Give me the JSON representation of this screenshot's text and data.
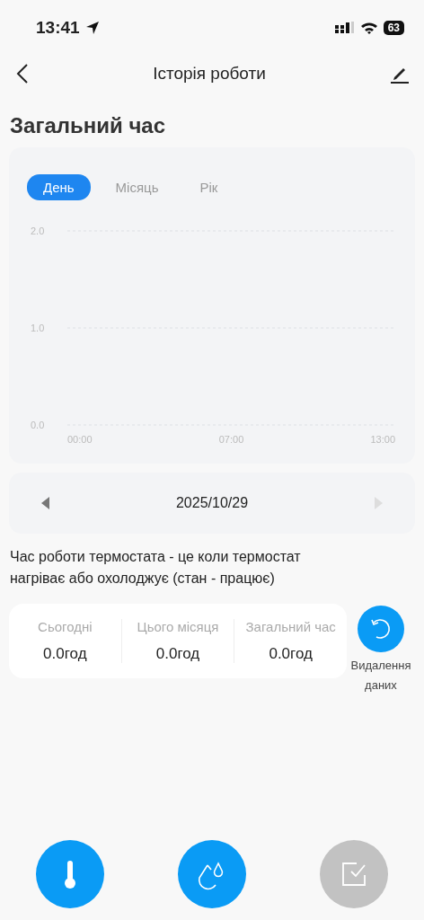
{
  "status_bar": {
    "time": "13:41",
    "battery": "63"
  },
  "nav": {
    "title": "Історія роботи"
  },
  "heading": "Загальний час",
  "chart_card": {
    "tabs": [
      {
        "label": "День",
        "selected": true
      },
      {
        "label": "Місяць",
        "selected": false
      },
      {
        "label": "Рік",
        "selected": false
      }
    ],
    "chart_data": {
      "type": "line",
      "categories": [
        "00:00",
        "07:00",
        "13:00"
      ],
      "ylim": [
        0,
        2
      ],
      "yticks": [
        {
          "value": 0,
          "label": "0.0"
        },
        {
          "value": 1,
          "label": "1.0"
        },
        {
          "value": 2,
          "label": "2.0"
        }
      ]
    }
  },
  "date_nav": {
    "date": "2025/10/29",
    "prev_disabled": false,
    "next_disabled": true
  },
  "description": "Час роботи термостата - це коли термостат нагріває або охолоджує (стан - працює)",
  "stats": [
    {
      "label": "Сьогодні",
      "value": "0.0год"
    },
    {
      "label": "Цього місяця",
      "value": "0.0год"
    },
    {
      "label": "Загальний час",
      "value": "0.0год"
    }
  ],
  "reset": {
    "label": "Видалення даних"
  },
  "bottom_buttons": [
    {
      "kind": "thermometer",
      "disabled": false
    },
    {
      "kind": "drops",
      "disabled": false
    },
    {
      "kind": "checkbox",
      "disabled": true
    }
  ]
}
